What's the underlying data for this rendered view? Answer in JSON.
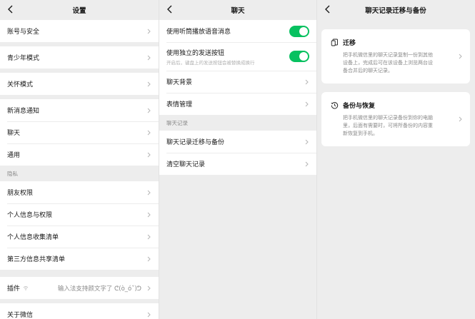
{
  "settings": {
    "title": "设置",
    "group1": [
      "账号与安全"
    ],
    "group2": [
      "青少年模式"
    ],
    "group3": [
      "关怀模式"
    ],
    "group4": [
      "新消息通知",
      "聊天",
      "通用"
    ],
    "privacy_label": "隐私",
    "group5": [
      "朋友权限",
      "个人信息与权限",
      "个人信息收集清单",
      "第三方信息共享清单"
    ],
    "plugin": {
      "label": "插件",
      "value": "输入法支持颜文字了 ᕦ(ò_óˇ)ᕤ"
    },
    "group7": [
      "关于微信"
    ]
  },
  "chat": {
    "title": "聊天",
    "toggle1": {
      "label": "使用听筒播放语音消息",
      "on": true
    },
    "toggle2": {
      "label": "使用独立的发送按钮",
      "sub": "开启后，键盘上的发送按钮会被替换成换行",
      "on": true
    },
    "items1": [
      "聊天背景",
      "表情管理"
    ],
    "section_label": "聊天记录",
    "items2": [
      "聊天记录迁移与备份",
      "清空聊天记录"
    ]
  },
  "migrate": {
    "title": "聊天记录迁移与备份",
    "cards": [
      {
        "icon": "migrate-icon",
        "title": "迁移",
        "desc": "把手机微信里的聊天记录复制一份到其他设备上，完成后可在该设备上浏览两台设备合并后的聊天记录。"
      },
      {
        "icon": "history-icon",
        "title": "备份与恢复",
        "desc": "把手机微信里的聊天记录备份到你的电脑里，后面有需要时，可将所备份的内容重新恢复到手机。"
      }
    ]
  },
  "colors": {
    "accent": "#07c160",
    "background": "#ededed",
    "text": "#191919",
    "secondary": "#8a8a8a"
  }
}
